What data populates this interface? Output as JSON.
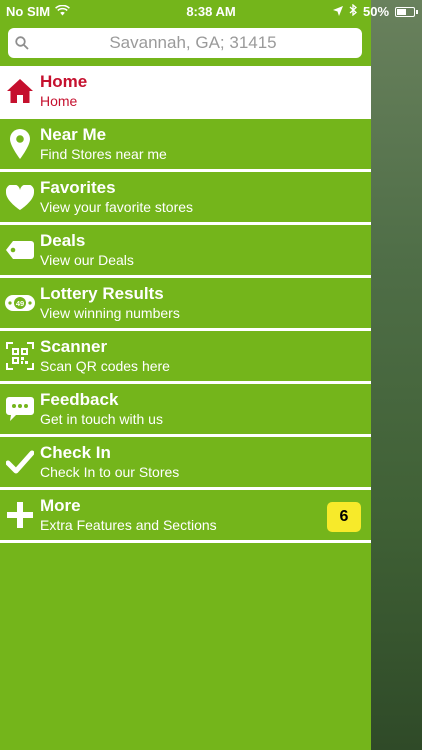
{
  "status_bar": {
    "carrier": "No SIM",
    "time": "8:38 AM",
    "battery": "50%",
    "icons": [
      "wifi-icon",
      "location-arrow-icon",
      "bluetooth-icon",
      "battery-icon"
    ]
  },
  "search": {
    "value": "Savannah, GA; 31415",
    "icon": "search-icon"
  },
  "colors": {
    "menu_bg": "#74b51b",
    "active_text": "#c5102e",
    "badge_bg": "#f7ea2a"
  },
  "menu": {
    "items": [
      {
        "title": "Home",
        "subtitle": "Home",
        "icon": "home-icon",
        "active": true
      },
      {
        "title": "Near Me",
        "subtitle": "Find Stores near me",
        "icon": "map-pin-icon"
      },
      {
        "title": "Favorites",
        "subtitle": "View your favorite stores",
        "icon": "heart-icon"
      },
      {
        "title": "Deals",
        "subtitle": "View our Deals",
        "icon": "tag-icon"
      },
      {
        "title": "Lottery Results",
        "subtitle": "View winning numbers",
        "icon": "lottery-ball-icon",
        "icon_text": "49"
      },
      {
        "title": "Scanner",
        "subtitle": "Scan QR codes here",
        "icon": "qr-scanner-icon"
      },
      {
        "title": "Feedback",
        "subtitle": "Get in touch with us",
        "icon": "chat-bubble-icon"
      },
      {
        "title": "Check In",
        "subtitle": "Check In to our Stores",
        "icon": "checkmark-icon"
      },
      {
        "title": "More",
        "subtitle": "Extra Features and Sections",
        "icon": "plus-icon",
        "badge": "6"
      }
    ]
  }
}
